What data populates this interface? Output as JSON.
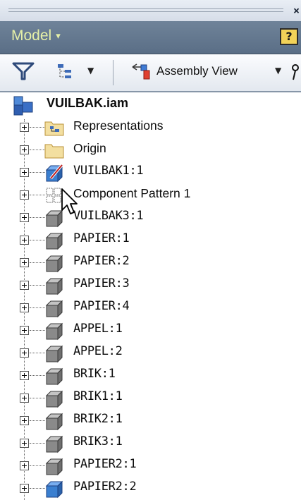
{
  "window": {
    "close_glyph": "×"
  },
  "header": {
    "title": "Model",
    "title_caret": "▾",
    "help_label": "?"
  },
  "toolbar": {
    "filter_icon": "funnel-icon",
    "tree_icon": "tree-display-icon",
    "tree_dropdown": "▼",
    "view_icon": "assembly-view-icon",
    "view_label": "Assembly View",
    "view_dropdown": "▼"
  },
  "tree": {
    "root": {
      "label": "VUILBAK.iam",
      "icon": "assembly-icon"
    },
    "items": [
      {
        "label": "Representations",
        "icon": "representations-folder-icon",
        "font": "sans"
      },
      {
        "label": "Origin",
        "icon": "folder-icon",
        "font": "sans"
      },
      {
        "label": "VUILBAK1:1",
        "icon": "edit-part-icon",
        "font": "mono"
      },
      {
        "label": "Component Pattern 1",
        "icon": "component-pattern-icon",
        "font": "sans"
      },
      {
        "label": "VUILBAK3:1",
        "icon": "part-gray-icon",
        "font": "mono"
      },
      {
        "label": "PAPIER:1",
        "icon": "part-gray-icon",
        "font": "mono"
      },
      {
        "label": "PAPIER:2",
        "icon": "part-gray-icon",
        "font": "mono"
      },
      {
        "label": "PAPIER:3",
        "icon": "part-gray-icon",
        "font": "mono"
      },
      {
        "label": "PAPIER:4",
        "icon": "part-gray-icon",
        "font": "mono"
      },
      {
        "label": "APPEL:1",
        "icon": "part-gray-icon",
        "font": "mono"
      },
      {
        "label": "APPEL:2",
        "icon": "part-gray-icon",
        "font": "mono"
      },
      {
        "label": "BRIK:1",
        "icon": "part-gray-icon",
        "font": "mono"
      },
      {
        "label": "BRIK1:1",
        "icon": "part-gray-icon",
        "font": "mono"
      },
      {
        "label": "BRIK2:1",
        "icon": "part-gray-icon",
        "font": "mono"
      },
      {
        "label": "BRIK3:1",
        "icon": "part-gray-icon",
        "font": "mono"
      },
      {
        "label": "PAPIER2:1",
        "icon": "part-gray-icon",
        "font": "mono"
      },
      {
        "label": "PAPIER2:2",
        "icon": "part-blue-icon",
        "font": "mono"
      }
    ]
  },
  "colors": {
    "title_bar": "#5f748c",
    "title_text": "#e5f0a8",
    "help_yellow": "#f2d258",
    "folder_yellow": "#f3dfa0",
    "part_gray": "#8a8a8a",
    "part_blue": "#3a7fd0",
    "assembly_blue": "#3a6fc6"
  }
}
